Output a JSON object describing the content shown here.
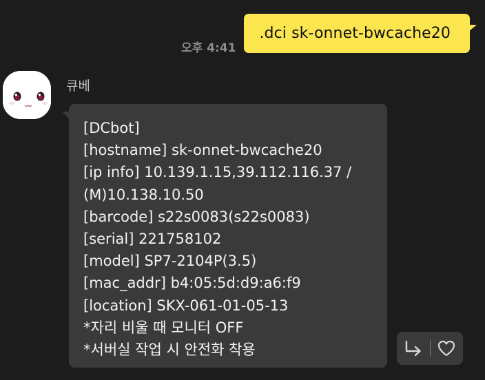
{
  "sent": {
    "time": "오후 4:41",
    "text": ".dci sk-onnet-bwcache20"
  },
  "received": {
    "sender_name": "큐베",
    "lines": [
      "[DCbot]",
      "[hostname] sk-onnet-bwcache20",
      "[ip info] 10.139.1.15,39.112.116.37 /",
      "(M)10.138.10.50",
      "[barcode] s22s0083(s22s0083)",
      "[serial] 221758102",
      "[model] SP7-2104P(3.5)",
      "[mac_addr] b4:05:5d:d9:a6:f9",
      "[location] SKX-061-01-05-13",
      "*자리 비울 때 모니터 OFF",
      "*서버실 작업 시 안전화 착용"
    ]
  },
  "icons": {
    "avatar": "white-bunny-avatar",
    "reply": "reply-arrow-icon",
    "like": "heart-icon"
  },
  "colors": {
    "background": "#1c1c1c",
    "sent_bubble": "#fce650",
    "received_bubble": "#3a3a3a"
  }
}
